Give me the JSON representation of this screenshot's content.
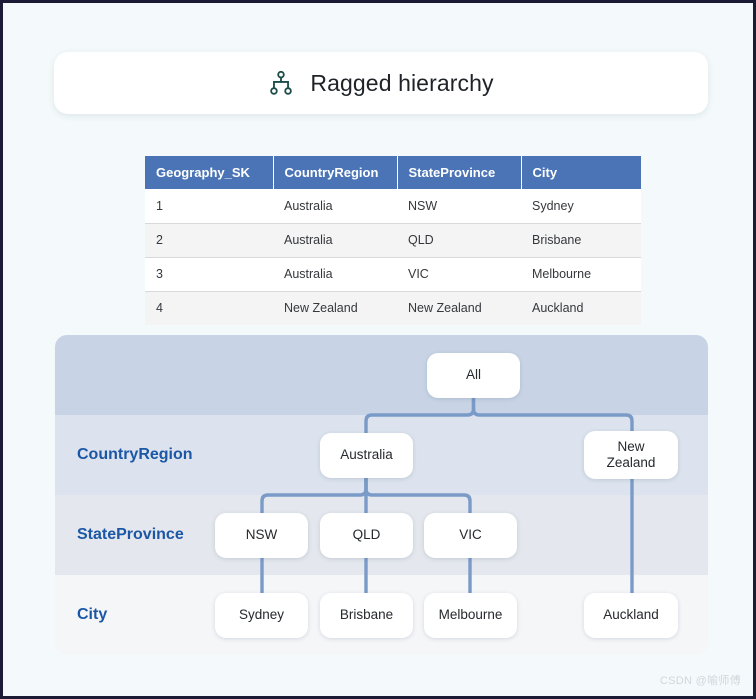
{
  "header": {
    "icon": "hierarchy-icon",
    "title": "Ragged hierarchy",
    "icon_color": "#1d4d48"
  },
  "table": {
    "columns": [
      "Geography_SK",
      "CountryRegion",
      "StateProvince",
      "City"
    ],
    "header_color": "#4a74b5",
    "rows": [
      [
        "1",
        "Australia",
        "NSW",
        "Sydney"
      ],
      [
        "2",
        "Australia",
        "QLD",
        "Brisbane"
      ],
      [
        "3",
        "Australia",
        "VIC",
        "Melbourne"
      ],
      [
        "4",
        "New Zealand",
        "New Zealand",
        "Auckland"
      ]
    ]
  },
  "hierarchy": {
    "bands": [
      {
        "label": "",
        "color": "#c8d4e6"
      },
      {
        "label": "CountryRegion",
        "color": "#dce3ee"
      },
      {
        "label": "StateProvince",
        "color": "#e4e7ed"
      },
      {
        "label": "City",
        "color": "#f5f6f8"
      }
    ],
    "label_color": "#1c57a5",
    "connector_color": "#7a9bc8",
    "nodes": {
      "root": "All",
      "country_australia": "Australia",
      "country_newzealand": "New\nZealand",
      "state_nsw": "NSW",
      "state_qld": "QLD",
      "state_vic": "VIC",
      "city_sydney": "Sydney",
      "city_brisbane": "Brisbane",
      "city_melbourne": "Melbourne",
      "city_auckland": "Auckland"
    }
  },
  "watermark": "CSDN @喻师傅"
}
